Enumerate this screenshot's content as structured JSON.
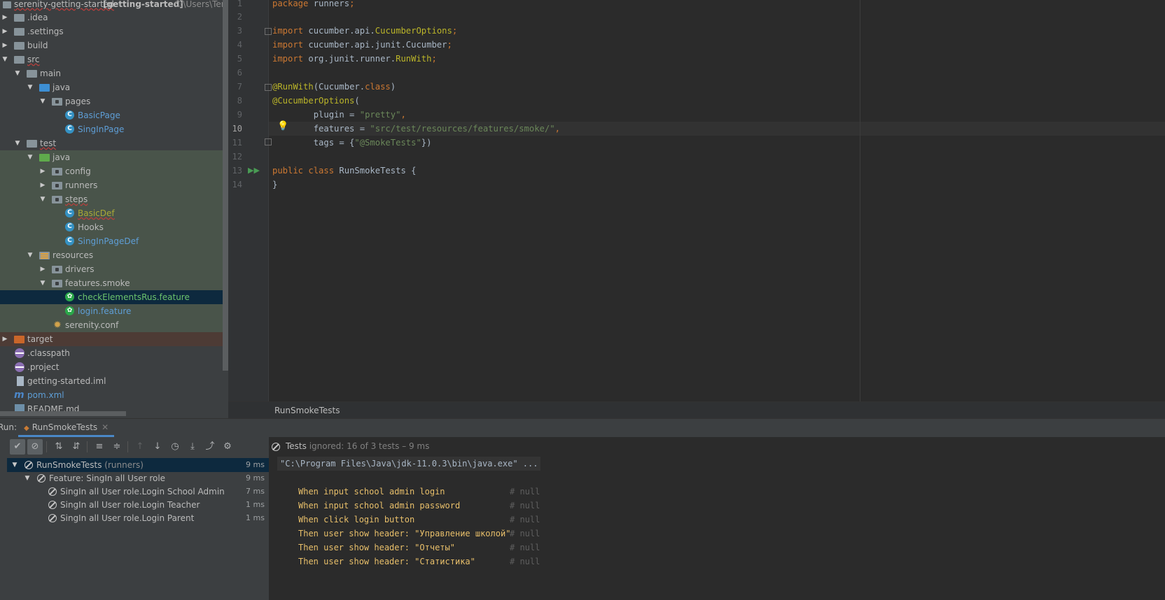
{
  "project_tree": {
    "root": {
      "name": "serenity-getting-started",
      "module": "[getting-started]",
      "path": "C:\\Users\\Temi"
    },
    "items": [
      {
        "label": ".idea"
      },
      {
        "label": ".settings"
      },
      {
        "label": "build"
      },
      {
        "label": "src"
      },
      {
        "label": "main"
      },
      {
        "label": "java"
      },
      {
        "label": "pages"
      },
      {
        "label": "BasicPage"
      },
      {
        "label": "SingInPage"
      },
      {
        "label": "test"
      },
      {
        "label": "java"
      },
      {
        "label": "config"
      },
      {
        "label": "runners"
      },
      {
        "label": "steps"
      },
      {
        "label": "BasicDef"
      },
      {
        "label": "Hooks"
      },
      {
        "label": "SingInPageDef"
      },
      {
        "label": "resources"
      },
      {
        "label": "drivers"
      },
      {
        "label": "features.smoke"
      },
      {
        "label": "checkElementsRus.feature"
      },
      {
        "label": "login.feature"
      },
      {
        "label": "serenity.conf"
      },
      {
        "label": "target"
      },
      {
        "label": ".classpath"
      },
      {
        "label": ".project"
      },
      {
        "label": "getting-started.iml"
      },
      {
        "label": "pom.xml"
      },
      {
        "label": "README.md"
      }
    ]
  },
  "editor": {
    "line_numbers": [
      "1",
      "2",
      "3",
      "4",
      "5",
      "6",
      "7",
      "8",
      "9",
      "10",
      "11",
      "12",
      "13",
      "14"
    ],
    "current_line": "10",
    "lines": {
      "l1": {
        "kw": "package",
        "rest": " runners",
        "semi": ";"
      },
      "l3": {
        "kw": "import",
        "pkg": " cucumber.api.",
        "cls": "CucumberOptions",
        "semi": ";"
      },
      "l4": {
        "kw": "import",
        "pkg": " cucumber.api.junit.Cucumber",
        "semi": ";"
      },
      "l5": {
        "kw": "import",
        "pkg": " org.junit.runner.",
        "cls": "RunWith",
        "semi": ";"
      },
      "l7": {
        "ann": "@RunWith",
        "open": "(Cucumber.",
        "kw": "class",
        "close": ")"
      },
      "l8": {
        "ann": "@CucumberOptions",
        "open": "("
      },
      "l9": {
        "key": "        plugin = ",
        "str": "\"pretty\"",
        "comma": ","
      },
      "l10": {
        "key": "        features = ",
        "str": "\"src/test/resources/features/smoke/\"",
        "comma": ","
      },
      "l11": {
        "key": "        tags = {",
        "str": "\"@SmokeTests\"",
        "close": "})"
      },
      "l13": {
        "kw": "public class",
        "rest": " RunSmokeTests {"
      },
      "l14": {
        "rest": "}"
      }
    },
    "breadcrumb": "RunSmokeTests"
  },
  "run_panel": {
    "label": "Run:",
    "tab_label": "RunSmokeTests",
    "status": {
      "prefix": "Tests ",
      "ignored": "ignored: 16",
      "suffix": " of 3 tests – 9 ms"
    },
    "tree": [
      {
        "label": "RunSmokeTests",
        "pkg": " (runners)",
        "time": "9 ms"
      },
      {
        "label": "Feature: SingIn all User role",
        "time": "9 ms"
      },
      {
        "label": "SingIn all User role.Login School Admin",
        "time": "7 ms"
      },
      {
        "label": "SingIn all User role.Login Teacher",
        "time": "1 ms"
      },
      {
        "label": "SingIn all User role.Login Parent",
        "time": "1 ms"
      }
    ],
    "console": {
      "command": "\"C:\\Program Files\\Java\\jdk-11.0.3\\bin\\java.exe\" ...",
      "steps": [
        {
          "text": "When input school admin login",
          "comment": "# null"
        },
        {
          "text": "When input school admin password",
          "comment": "# null"
        },
        {
          "text": "When click login button",
          "comment": "# null"
        },
        {
          "text": "Then user show header: \"Управление школой\"",
          "comment": "# null"
        },
        {
          "text": "Then user show header: \"Отчеты\"",
          "comment": "# null"
        },
        {
          "text": "Then user show header: \"Статистика\"",
          "comment": "# null"
        }
      ]
    }
  },
  "colors": {
    "accent": "#4a88c7",
    "selection": "#0d293e",
    "test_bg": "#49544a",
    "keyword": "#cc7832",
    "string": "#6a8759",
    "annotation": "#bbb529"
  }
}
